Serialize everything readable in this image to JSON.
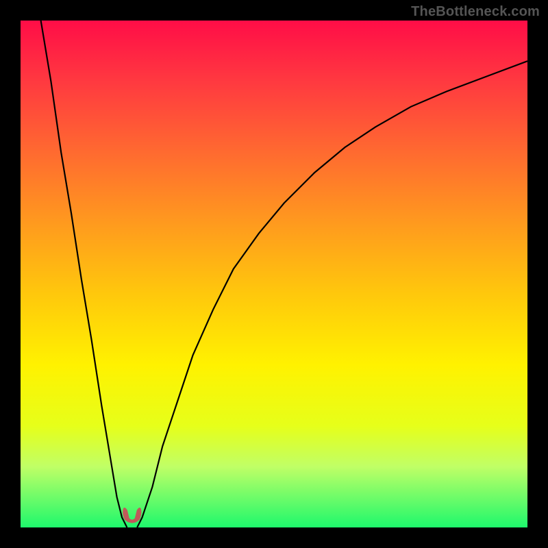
{
  "watermark": "TheBottleneck.com",
  "colors": {
    "background": "#000000",
    "gradient_top": "#ff0d47",
    "gradient_mid": "#fff200",
    "gradient_bottom": "#1ef86c",
    "curve": "#000000",
    "marker": "#c05a5a"
  },
  "chart_data": {
    "type": "line",
    "title": "",
    "xlabel": "",
    "ylabel": "",
    "xlim": [
      0,
      100
    ],
    "ylim": [
      0,
      100
    ],
    "grid": false,
    "legend": false,
    "series": [
      {
        "name": "left_branch",
        "x": [
          4,
          6,
          8,
          10,
          12,
          14,
          16,
          18,
          19,
          20,
          21
        ],
        "y": [
          100,
          88,
          74,
          62,
          49,
          37,
          24,
          12,
          6,
          2,
          0
        ]
      },
      {
        "name": "right_branch",
        "x": [
          23,
          24,
          26,
          28,
          31,
          34,
          38,
          42,
          47,
          52,
          58,
          64,
          70,
          77,
          84,
          92,
          100
        ],
        "y": [
          0,
          2,
          8,
          16,
          25,
          34,
          43,
          51,
          58,
          64,
          70,
          75,
          79,
          83,
          86,
          89,
          92
        ]
      }
    ],
    "marker": {
      "x": 22,
      "y": 1,
      "note": "minimum / optimum point"
    }
  }
}
